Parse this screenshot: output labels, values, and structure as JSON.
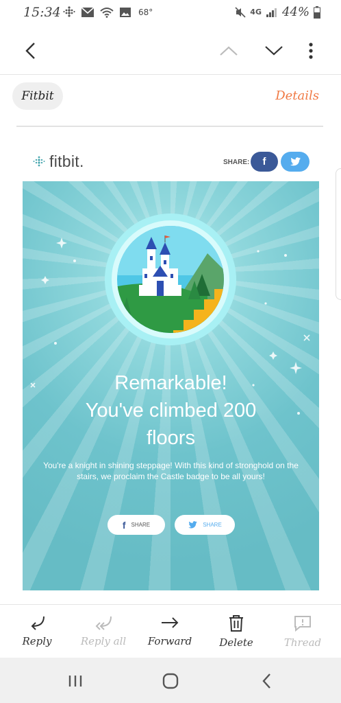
{
  "status_bar": {
    "time": "15:34",
    "temperature": "68°",
    "network": "4G",
    "battery": "44%"
  },
  "email": {
    "sender_chip": "Fitbit",
    "details_label": "Details"
  },
  "content": {
    "brand": "fitbit.",
    "share_label": "SHARE:",
    "fb_glyph": "f",
    "headline_line1": "Remarkable!",
    "headline_line2": "You've climbed 200",
    "headline_line3": "floors",
    "body": "You're a knight in shining steppage! With this kind of stronghold on the stairs, we proclaim the Castle badge to be all yours!",
    "share_fb_label": "SHARE",
    "share_tw_label": "SHARE"
  },
  "bottom_actions": [
    {
      "label": "Reply",
      "enabled": true
    },
    {
      "label": "Reply all",
      "enabled": false
    },
    {
      "label": "Forward",
      "enabled": true
    },
    {
      "label": "Delete",
      "enabled": true
    },
    {
      "label": "Thread",
      "enabled": false
    }
  ],
  "colors": {
    "accent": "#f07a45",
    "facebook": "#3b5998",
    "twitter": "#55acee",
    "hero_bg": "#6ec3cc"
  }
}
